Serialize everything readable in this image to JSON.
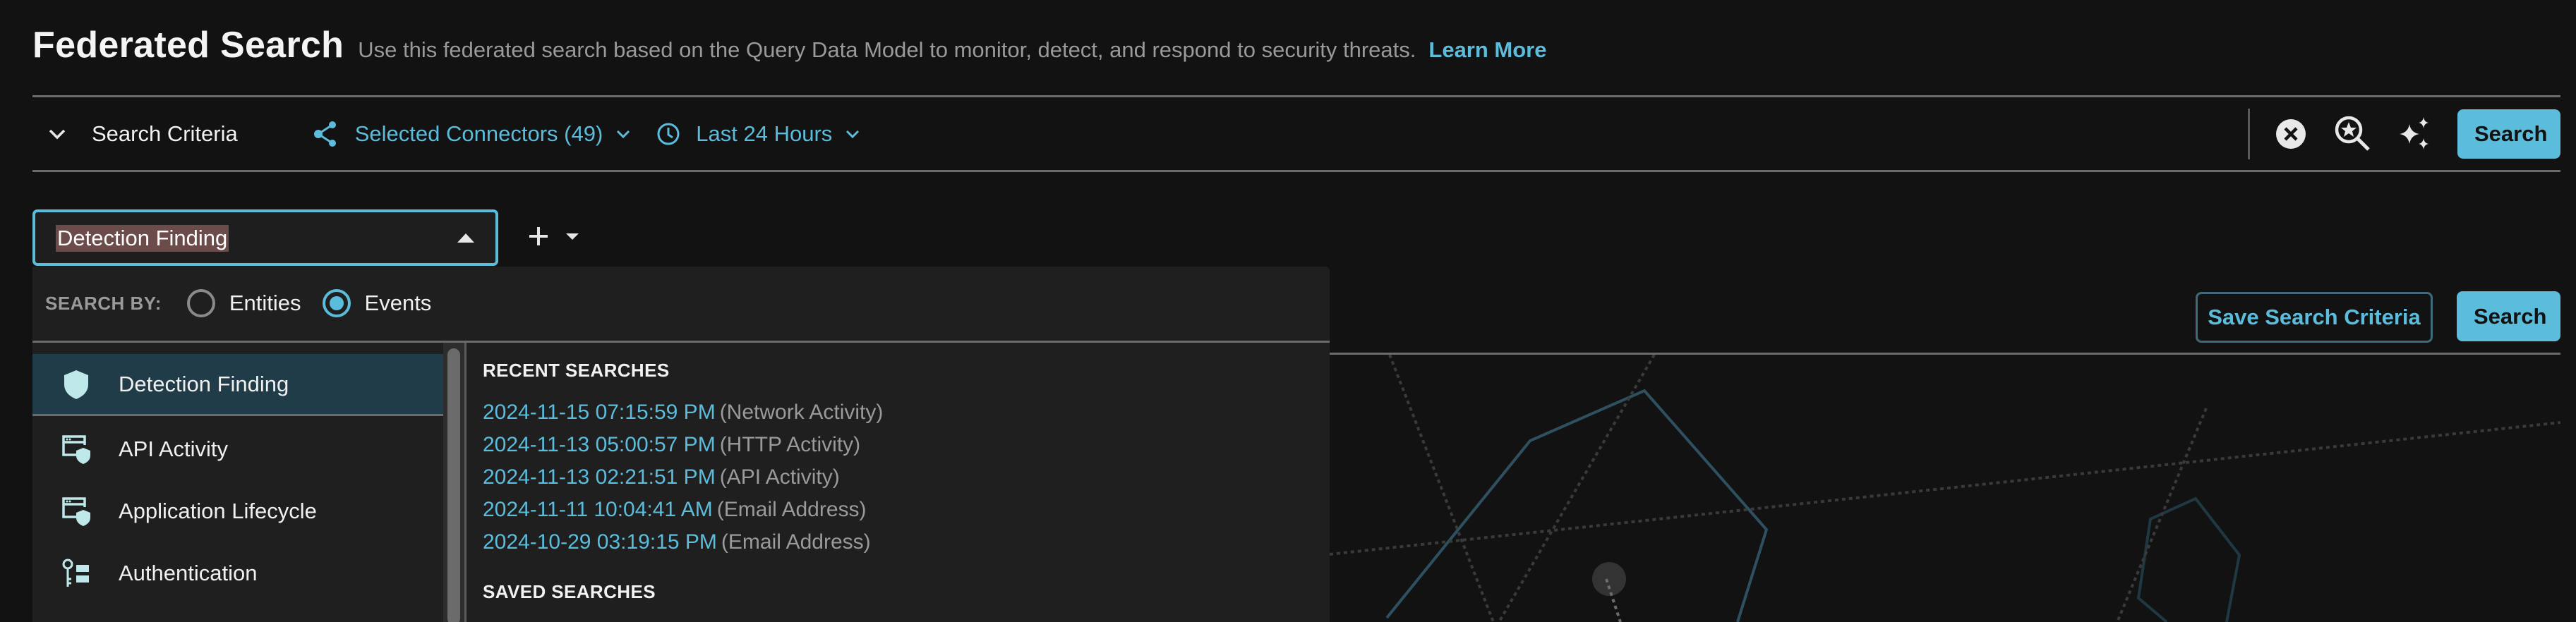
{
  "header": {
    "title": "Federated Search",
    "description": "Use this federated search based on the Query Data Model to monitor, detect, and respond to security threats.",
    "learn_more": "Learn More"
  },
  "toolbar": {
    "criteria_label": "Search Criteria",
    "criteria_icon": "chevron-down-icon",
    "connectors_label": "Selected Connectors (49)",
    "connectors_icon": "share-nodes-icon",
    "time_label": "Last 24 Hours",
    "time_icon": "clock-icon",
    "clear_icon": "clear-circle-icon",
    "saved_search_icon": "search-star-icon",
    "ai_icon": "sparkles-icon",
    "search_label": "Search"
  },
  "query": {
    "selected_type": "Detection Finding",
    "add_icon": "plus-icon",
    "add_caret_icon": "caret-down-icon"
  },
  "actions": {
    "save_criteria_label": "Save Search Criteria",
    "search_label": "Search"
  },
  "dropdown": {
    "search_by_label": "SEARCH BY:",
    "options": [
      {
        "label": "Entities",
        "selected": false
      },
      {
        "label": "Events",
        "selected": true
      }
    ],
    "categories": [
      {
        "label": "Detection Finding",
        "icon": "shield-icon",
        "selected": true
      },
      {
        "label": "API Activity",
        "icon": "app-window-shield-icon",
        "selected": false
      },
      {
        "label": "Application Lifecycle",
        "icon": "app-window-shield-icon",
        "selected": false
      },
      {
        "label": "Authentication",
        "icon": "key-list-icon",
        "selected": false
      }
    ],
    "recent_title": "RECENT SEARCHES",
    "recent_searches": [
      {
        "time": "2024-11-15 07:15:59 PM",
        "type": "(Network Activity)"
      },
      {
        "time": "2024-11-13 05:00:57 PM",
        "type": "(HTTP Activity)"
      },
      {
        "time": "2024-11-13 02:21:51 PM",
        "type": "(API Activity)"
      },
      {
        "time": "2024-11-11 10:04:41 AM",
        "type": "(Email Address)"
      },
      {
        "time": "2024-10-29 03:19:15 PM",
        "type": "(Email Address)"
      }
    ],
    "saved_title": "SAVED SEARCHES"
  },
  "colors": {
    "accent": "#5bbcdc",
    "background": "#121212",
    "panel": "#1f1f1f",
    "selected_row": "#203c48",
    "text_muted": "#9a9a9a"
  }
}
